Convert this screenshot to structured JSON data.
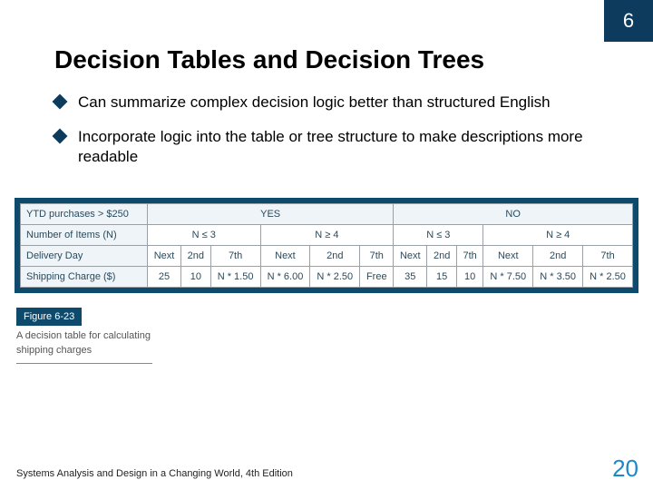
{
  "chapter": "6",
  "title": "Decision Tables and Decision Trees",
  "bullets": [
    "Can summarize complex decision logic better than structured English",
    "Incorporate logic into the table or tree structure to make descriptions more readable"
  ],
  "chart_data": {
    "type": "table",
    "title": "A decision table for calculating shipping charges",
    "row_headers": [
      "YTD purchases > $250",
      "Number of Items (N)",
      "Delivery Day",
      "Shipping Charge ($)"
    ],
    "top_groups": [
      "YES",
      "NO"
    ],
    "n_groups": [
      "N ≤ 3",
      "N ≥ 4",
      "N ≤ 3",
      "N ≥ 4"
    ],
    "delivery_days": [
      "Next",
      "2nd",
      "7th",
      "Next",
      "2nd",
      "7th",
      "Next",
      "2nd",
      "7th",
      "Next",
      "2nd",
      "7th"
    ],
    "shipping": [
      "25",
      "10",
      "N * 1.50",
      "N * 6.00",
      "N * 2.50",
      "Free",
      "35",
      "15",
      "10",
      "N * 7.50",
      "N * 3.50",
      "N * 2.50"
    ]
  },
  "figure": {
    "label": "Figure 6-23",
    "caption": "A decision table for calculating shipping charges"
  },
  "footer": "Systems Analysis and Design in a Changing World, 4th Edition",
  "page": "20"
}
